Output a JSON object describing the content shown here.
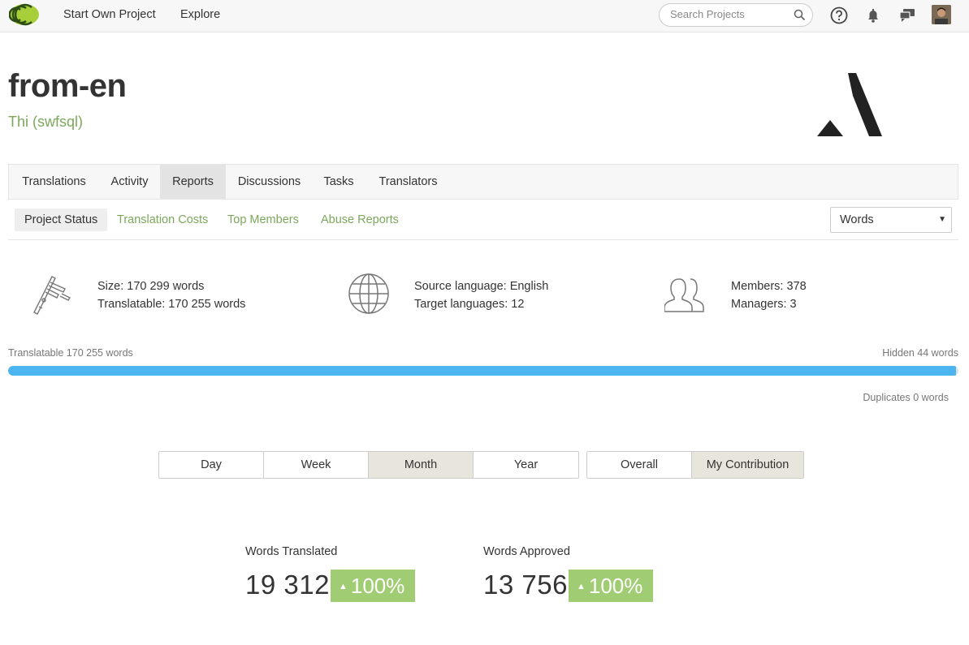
{
  "nav": {
    "start_project": "Start Own Project",
    "explore": "Explore",
    "search_placeholder": "Search Projects"
  },
  "header": {
    "title": "from-en",
    "owner": "Thi (swfsql)"
  },
  "tabs": [
    "Translations",
    "Activity",
    "Reports",
    "Discussions",
    "Tasks",
    "Translators"
  ],
  "active_tab": "Reports",
  "subtabs": [
    "Project Status",
    "Translation Costs",
    "Top Members",
    "Abuse Reports"
  ],
  "active_subtab": "Project Status",
  "unit_select": "Words",
  "stats": {
    "size": "Size: 170 299 words",
    "translatable": "Translatable: 170 255 words",
    "source_language": "Source language: English",
    "target_languages": "Target languages: 12",
    "members": "Members: 378",
    "managers": "Managers: 3"
  },
  "progress": {
    "translatable_label": "Translatable 170 255 words",
    "hidden_label": "Hidden 44 words",
    "duplicates_label": "Duplicates 0 words",
    "translated_fraction": 0.9974
  },
  "periods": [
    "Day",
    "Week",
    "Month",
    "Year"
  ],
  "active_period": "Month",
  "scopes": [
    "Overall",
    "My Contribution"
  ],
  "active_scope": "My Contribution",
  "counters": {
    "translated_label": "Words Translated",
    "translated_value": "19 312",
    "translated_change": "100%",
    "approved_label": "Words Approved",
    "approved_value": "13 756",
    "approved_change": "100%"
  },
  "colors": {
    "accent_green": "#7ba85b",
    "badge_green": "#a0cd73",
    "progress_blue": "#4cb4ee",
    "active_segment": "#e8e5dc"
  }
}
